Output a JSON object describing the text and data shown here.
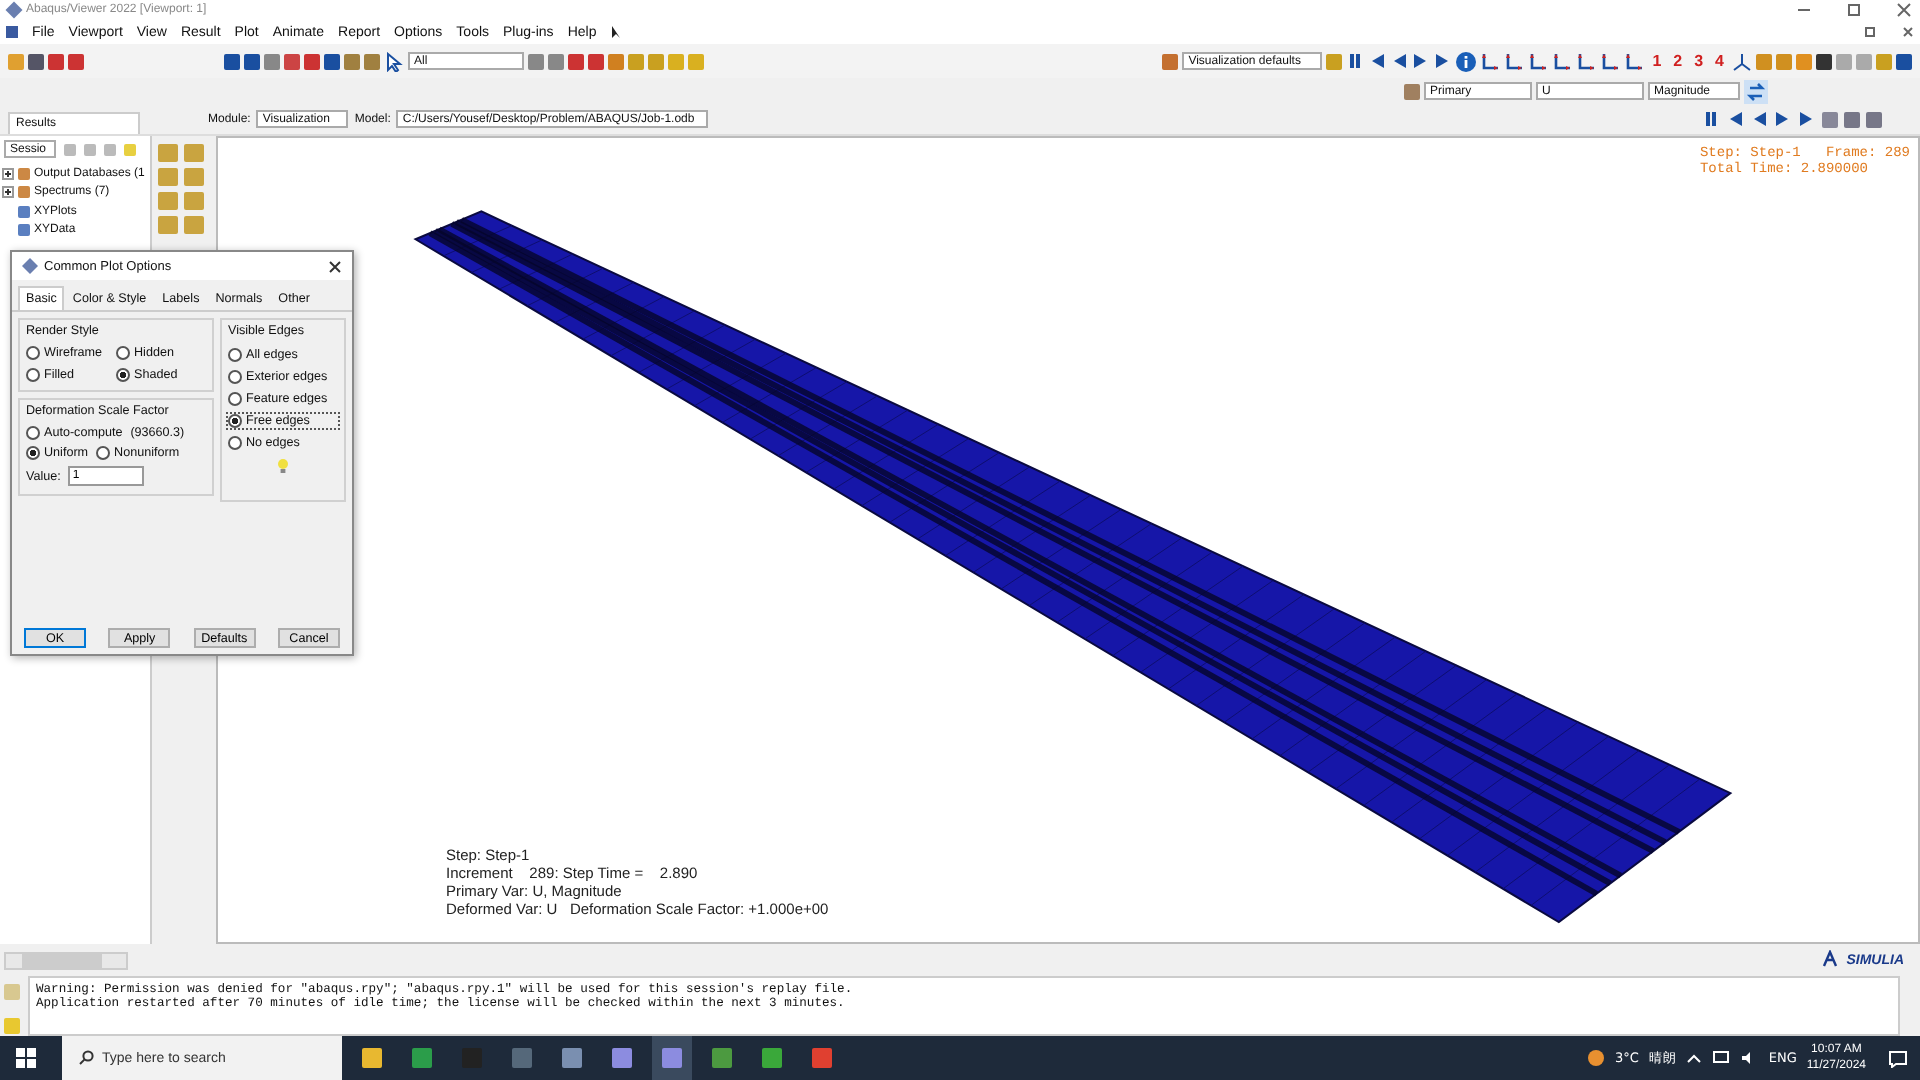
{
  "window": {
    "title": "Abaqus/Viewer 2022 [Viewport: 1]"
  },
  "menu": [
    "File",
    "Viewport",
    "View",
    "Result",
    "Plot",
    "Animate",
    "Report",
    "Options",
    "Tools",
    "Plug-ins",
    "Help"
  ],
  "toolbar": {
    "selection_filter": "All",
    "view_defaults": "Visualization defaults",
    "view_numbers": [
      "1",
      "2",
      "3",
      "4"
    ]
  },
  "field_output": {
    "position": "Primary",
    "variable": "U",
    "component": "Magnitude"
  },
  "context": {
    "module_label": "Module:",
    "module": "Visualization",
    "model_label": "Model:",
    "model": "C:/Users/Yousef/Desktop/Problem/ABAQUS/Job-1.odb"
  },
  "results_panel": {
    "tab": "Results",
    "session_combo": "Sessio",
    "tree": [
      {
        "label": "Output Databases (1",
        "expandable": true
      },
      {
        "label": "Spectrums (7)",
        "expandable": true
      },
      {
        "label": "XYPlots",
        "expandable": false
      },
      {
        "label": "XYData",
        "expandable": false
      }
    ]
  },
  "dialog": {
    "title": "Common Plot Options",
    "tabs": [
      {
        "label": "Basic",
        "selected": true
      },
      {
        "label": "Color & Style",
        "selected": false
      },
      {
        "label": "Labels",
        "selected": false
      },
      {
        "label": "Normals",
        "selected": false
      },
      {
        "label": "Other",
        "selected": false
      }
    ],
    "render_style": {
      "title": "Render Style",
      "options": [
        {
          "label": "Wireframe",
          "selected": false
        },
        {
          "label": "Hidden",
          "selected": false
        },
        {
          "label": "Filled",
          "selected": false
        },
        {
          "label": "Shaded",
          "selected": true
        }
      ]
    },
    "deformation_scale": {
      "title": "Deformation Scale Factor",
      "auto": {
        "label": "Auto-compute",
        "note": "(93660.3)",
        "selected": false
      },
      "options": [
        {
          "label": "Uniform",
          "selected": true
        },
        {
          "label": "Nonuniform",
          "selected": false
        }
      ],
      "value_label": "Value:",
      "value": "1"
    },
    "visible_edges": {
      "title": "Visible Edges",
      "options": [
        {
          "label": "All edges",
          "selected": false
        },
        {
          "label": "Exterior edges",
          "selected": false
        },
        {
          "label": "Feature edges",
          "selected": false
        },
        {
          "label": "Free edges",
          "selected": true
        },
        {
          "label": "No edges",
          "selected": false
        }
      ]
    },
    "buttons": [
      "OK",
      "Apply",
      "Defaults",
      "Cancel"
    ]
  },
  "viewport": {
    "state_block": [
      "Step: Step-1   Frame: 289",
      "Total Time: 2.890000"
    ],
    "legend": [
      "Step: Step-1",
      "Increment    289: Step Time =    2.890",
      "Primary Var: U, Magnitude",
      "Deformed Var: U   Deformation Scale Factor: +1.000e+00"
    ],
    "brand": "SIMULIA"
  },
  "messages": [
    "Warning: Permission was denied for \"abaqus.rpy\"; \"abaqus.rpy.1\" will be used for this session's replay file.",
    "Application restarted after 70 minutes of idle time; the license will be checked within the next 3 minutes."
  ],
  "taskbar": {
    "search_placeholder": "Type here to search",
    "temperature": "3°C",
    "weather": "晴朗",
    "language": "ENG",
    "time": "10:07 AM",
    "date": "11/27/2024"
  }
}
